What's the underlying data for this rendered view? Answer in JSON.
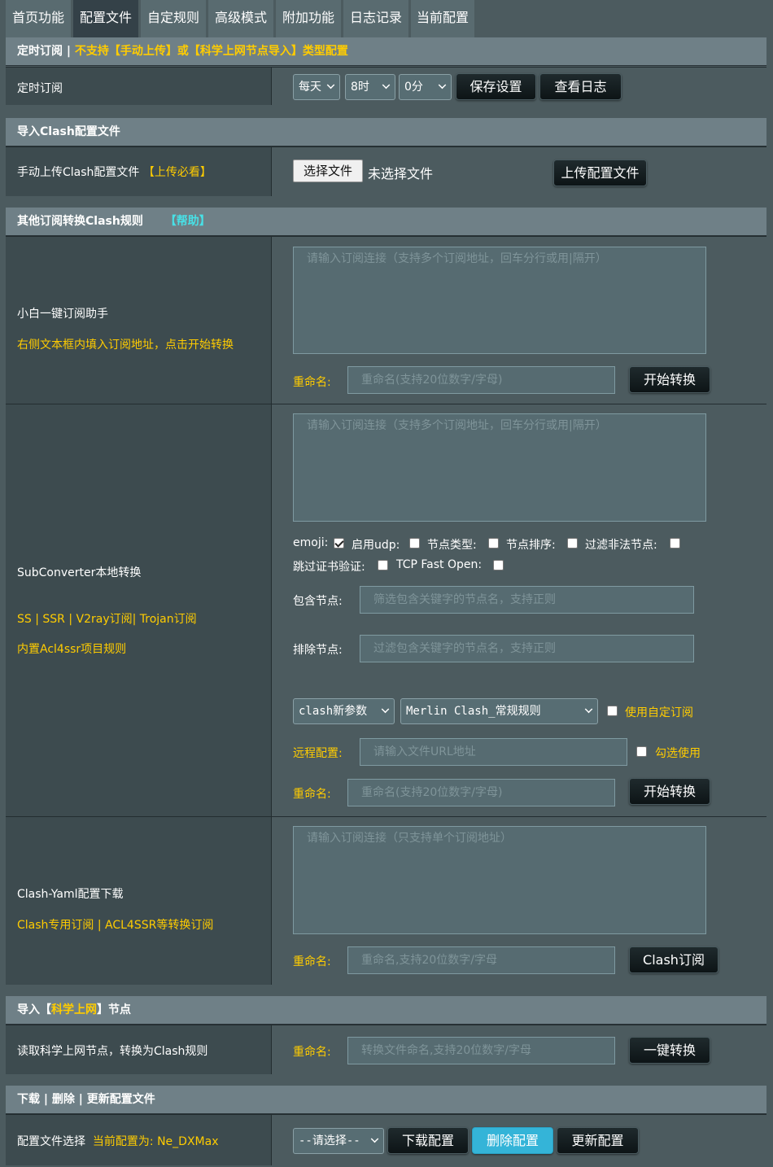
{
  "tabs": [
    "首页功能",
    "配置文件",
    "自定规则",
    "高级模式",
    "附加功能",
    "日志记录",
    "当前配置"
  ],
  "active_tab": 1,
  "timed": {
    "header_prefix": "定时订阅 | ",
    "header_note": "不支持【手动上传】或【科学上网节点导入】类型配置",
    "label": "定时订阅",
    "day": "每天",
    "hour": "8时",
    "minute": "0分",
    "save_btn": "保存设置",
    "log_btn": "查看日志"
  },
  "import_clash": {
    "header": "导入Clash配置文件",
    "label": "手动上传Clash配置文件",
    "must_read": "【上传必看】",
    "choose_file": "选择文件",
    "no_file": "未选择文件",
    "upload_btn": "上传配置文件"
  },
  "convert": {
    "header": "其他订阅转换Clash规则",
    "help": "【帮助】",
    "assistant": {
      "title": "小白一键订阅助手",
      "hint": "右侧文本框内填入订阅地址，点击开始转换",
      "textarea_placeholder": "请输入订阅连接（支持多个订阅地址，回车分行或用|隔开）",
      "rename_label": "重命名:",
      "rename_placeholder": "重命名(支持20位数字/字母)",
      "start_btn": "开始转换"
    },
    "subconverter": {
      "title": "SubConverter本地转换",
      "line1": "SS | SSR | V2ray订阅| Trojan订阅",
      "line2": "内置Acl4ssr项目规则",
      "textarea_placeholder": "请输入订阅连接（支持多个订阅地址，回车分行或用|隔开）",
      "emoji": "emoji:",
      "udp": "启用udp:",
      "node_type": "节点类型:",
      "node_sort": "节点排序:",
      "filter_illegal": "过滤非法节点:",
      "skip_cert": "跳过证书验证:",
      "tfo": "TCP Fast Open:",
      "include_label": "包含节点:",
      "include_placeholder": "筛选包含关键字的节点名，支持正则",
      "exclude_label": "排除节点:",
      "exclude_placeholder": "过滤包含关键字的节点名，支持正则",
      "param_select": "clash新参数",
      "rule_select": "Merlin Clash_常规规则",
      "custom_sub": "使用自定订阅",
      "remote_label": "远程配置:",
      "remote_placeholder": "请输入文件URL地址",
      "tick_use": "勾选使用",
      "rename_label": "重命名:",
      "rename_placeholder": "重命名(支持20位数字/字母)",
      "start_btn": "开始转换"
    },
    "yaml": {
      "title": "Clash-Yaml配置下载",
      "hint": "Clash专用订阅 | ACL4SSR等转换订阅",
      "textarea_placeholder": "请输入订阅连接（只支持单个订阅地址）",
      "rename_label": "重命名:",
      "rename_placeholder": "重命名,支持20位数字/字母",
      "btn": "Clash订阅"
    }
  },
  "import_nodes": {
    "header_prefix": "导入【",
    "header_highlight": "科学上网",
    "header_suffix": "】节点",
    "label": "读取科学上网节点，转换为Clash规则",
    "rename_label": "重命名:",
    "rename_placeholder": "转换文件命名,支持20位数字/字母",
    "btn": "一键转换"
  },
  "manage": {
    "header": "下载 | 删除 | 更新配置文件",
    "label": "配置文件选择",
    "current_label": "当前配置为: ",
    "current_value": "Ne_DXMax",
    "select": "--请选择--",
    "download_btn": "下载配置",
    "delete_btn": "删除配置",
    "update_btn": "更新配置"
  },
  "colors": {
    "accent_yellow": "#ffcc00",
    "help_cyan": "#48e0e6",
    "delete_button": "#34b4d8"
  }
}
